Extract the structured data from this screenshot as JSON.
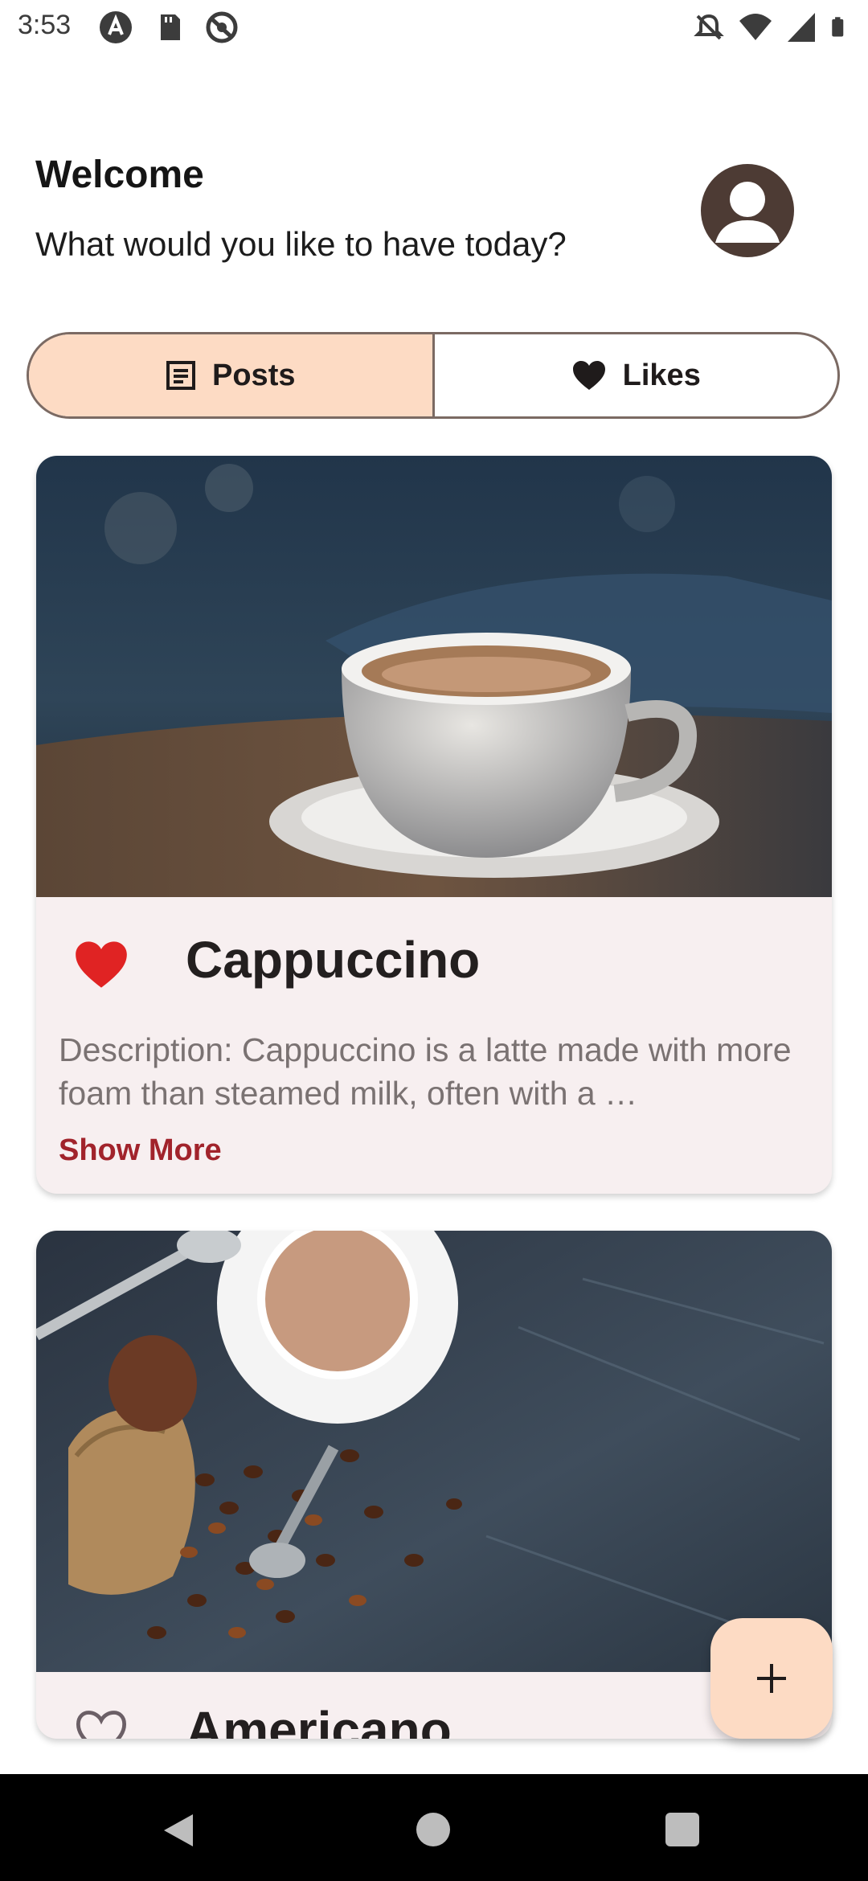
{
  "status_bar": {
    "time": "3:53",
    "left_icons": [
      "a-icon",
      "sd-card-icon",
      "at-icon"
    ],
    "right_icons": [
      "mute-icon",
      "wifi-icon",
      "signal-icon",
      "battery-icon"
    ]
  },
  "header": {
    "title": "Welcome",
    "subtitle": "What would you like to have today?",
    "avatar_icon": "account-circle-icon"
  },
  "segmented": {
    "posts_label": "Posts",
    "likes_label": "Likes",
    "selected": "Posts"
  },
  "posts": [
    {
      "title": "Cappuccino",
      "description": "Description: Cappuccino is a latte made with more foam than steamed milk, often with a …",
      "show_more": "Show More",
      "liked": true
    },
    {
      "title": "Americano",
      "liked": false
    }
  ],
  "fab": {
    "icon": "plus-icon"
  },
  "colors": {
    "accent": "#fddbc4",
    "like_red": "#e02323",
    "show_more": "#a1232b",
    "card_bg": "#f7eff0"
  }
}
